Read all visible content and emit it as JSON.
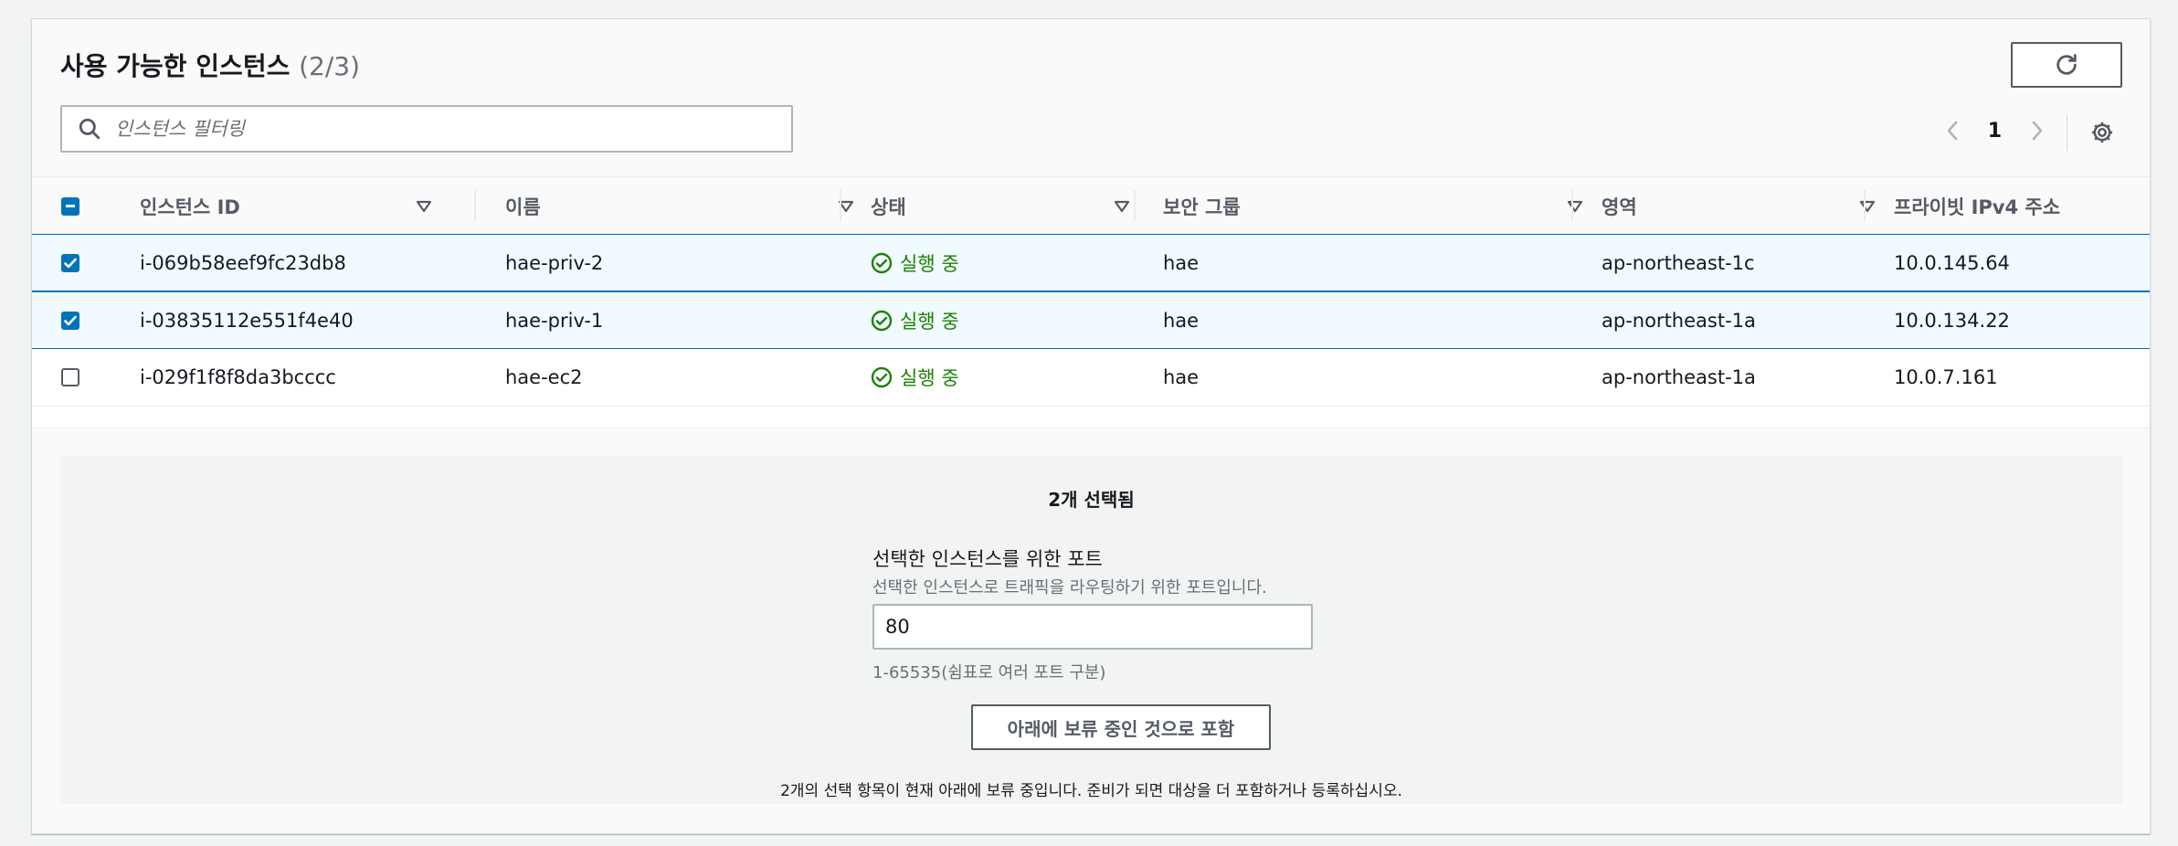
{
  "header": {
    "title": "사용 가능한 인스턴스",
    "count": "(2/3)"
  },
  "search": {
    "placeholder": "인스턴스 필터링",
    "value": ""
  },
  "pagination": {
    "current_page": "1"
  },
  "table": {
    "columns": [
      "인스턴스 ID",
      "이름",
      "상태",
      "보안 그룹",
      "영역",
      "프라이빗 IPv4 주소"
    ],
    "rows": [
      {
        "id": "i-069b58eef9fc23db8",
        "name": "hae-priv-2",
        "status": "실행 중",
        "security_group": "hae",
        "zone": "ap-northeast-1c",
        "ip": "10.0.145.64",
        "selected": true
      },
      {
        "id": "i-03835112e551f4e40",
        "name": "hae-priv-1",
        "status": "실행 중",
        "security_group": "hae",
        "zone": "ap-northeast-1a",
        "ip": "10.0.134.22",
        "selected": true
      },
      {
        "id": "i-029f1f8f8da3bcccc",
        "name": "hae-ec2",
        "status": "실행 중",
        "security_group": "hae",
        "zone": "ap-northeast-1a",
        "ip": "10.0.7.161",
        "selected": false
      }
    ]
  },
  "selection": {
    "heading": "2개 선택됨",
    "port_label": "선택한 인스턴스를 위한 포트",
    "port_description": "선택한 인스턴스로 트래픽을 라우팅하기 위한 포트입니다.",
    "port_value": "80",
    "port_hint": "1-65535(쉼표로 여러 포트 구분)",
    "include_button": "아래에 보류 중인 것으로 포함",
    "footer_note": "2개의 선택 항목이 현재 아래에 보류 중입니다. 준비가 되면 대상을 더 포함하거나 등록하십시오."
  },
  "colors": {
    "accent": "#0073bb",
    "status_running": "#1d8102"
  }
}
